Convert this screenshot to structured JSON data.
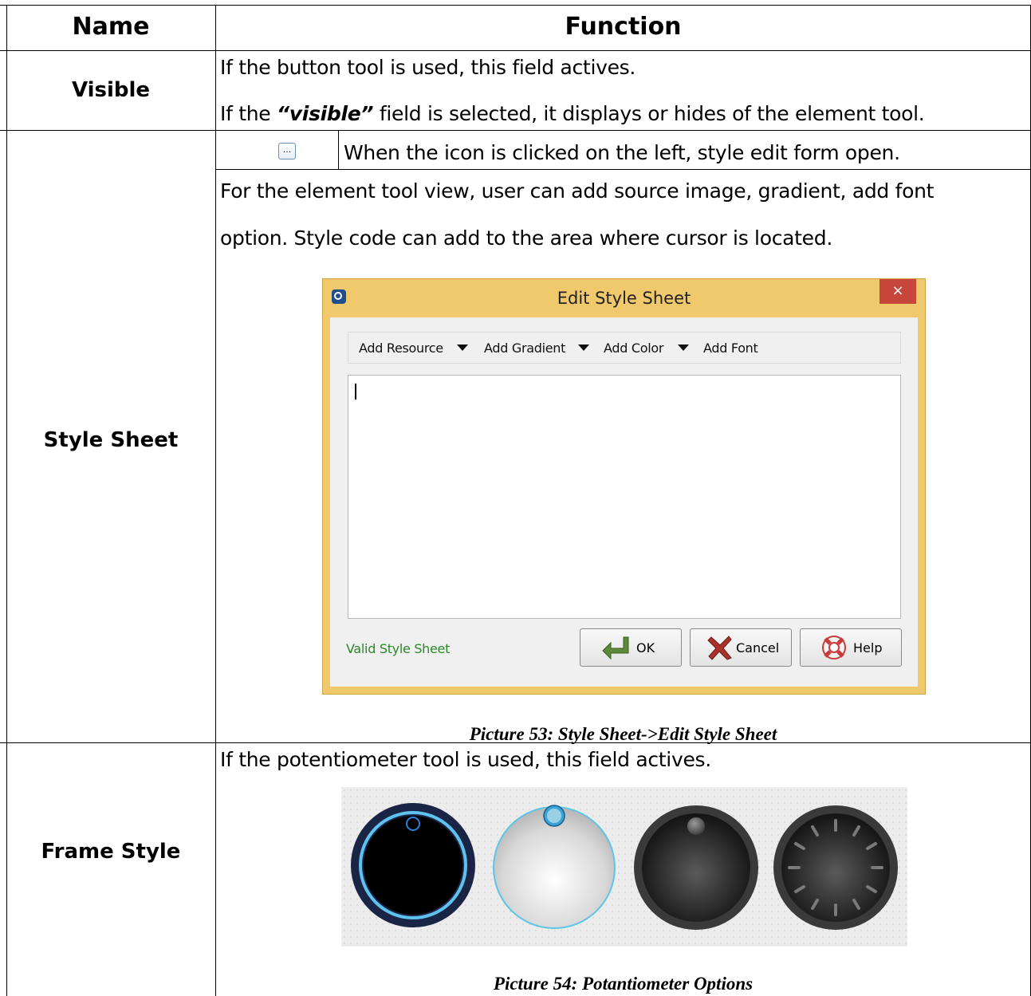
{
  "header": {
    "name": "Name",
    "function": "Function"
  },
  "rows": {
    "visible": {
      "name": "Visible",
      "line1": "If the button tool is used, this field actives.",
      "line2_prefix": "If the ",
      "line2_em": "“visible”",
      "line2_suffix": " field is selected, it displays or hides of the element tool."
    },
    "style_sheet": {
      "name": "Style Sheet",
      "icon_text": "...",
      "icon_desc": "When the icon is clicked on the left, style edit form open.",
      "para_line1": "For the element tool view, user can add source image, gradient, add font",
      "para_line2": "option. Style code can add to the area where cursor is located.",
      "caption": "Picture 53: Style Sheet->Edit Style Sheet"
    },
    "frame_style": {
      "name": "Frame Style",
      "line1": "If the potentiometer tool is used, this field actives.",
      "caption": "Picture 54: Potantiometer Options"
    }
  },
  "dialog": {
    "title": "Edit Style Sheet",
    "close": "×",
    "toolbar": [
      "Add Resource",
      "Add Gradient",
      "Add Color",
      "Add Font"
    ],
    "status": "Valid Style Sheet",
    "buttons": {
      "ok": "OK",
      "cancel": "Cancel",
      "help": "Help"
    },
    "colors": {
      "frame": "#f0c96c",
      "close": "#c7463b",
      "status": "#2a8a2a"
    }
  },
  "knobs": [
    {
      "style": "dark-blue-ring"
    },
    {
      "style": "light-silver"
    },
    {
      "style": "dark-gray"
    },
    {
      "style": "dark-gray-ticks"
    }
  ]
}
